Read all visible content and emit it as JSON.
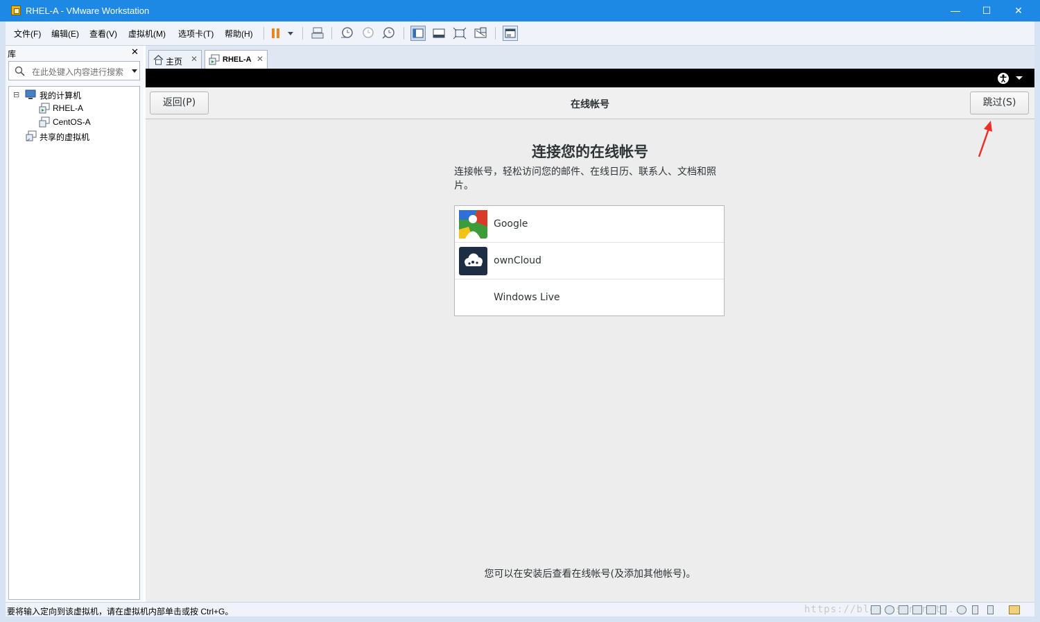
{
  "window": {
    "title": "RHEL-A - VMware Workstation",
    "minimize": "—",
    "maximize": "☐",
    "close": "✕"
  },
  "menu": [
    "文件(F)",
    "编辑(E)",
    "查看(V)",
    "虚拟机(M)",
    "选项卡(T)",
    "帮助(H)"
  ],
  "toolbar": {
    "icons": [
      "pause-icon",
      "send-keys-icon",
      "snapshot-take-icon",
      "snapshot-revert-icon",
      "snapshot-manager-icon",
      "library-view-icon",
      "console-view-icon",
      "fullscreen-icon",
      "unity-icon",
      "thumbnail-icon"
    ]
  },
  "library": {
    "title": "库",
    "close": "✕",
    "search_placeholder": "在此处键入内容进行搜索",
    "tree": {
      "root": "我的计算机",
      "expander": "⊟",
      "vms": [
        "RHEL-A",
        "CentOS-A"
      ],
      "shared": "共享的虚拟机"
    }
  },
  "tabs": [
    {
      "label": "主页",
      "close": "✕",
      "active": false
    },
    {
      "label": "RHEL-A",
      "close": "✕",
      "active": true
    }
  ],
  "vm": {
    "header": {
      "back_label": "返回(P)",
      "title": "在线帐号",
      "skip_label": "跳过(S)"
    },
    "heading": "连接您的在线帐号",
    "subtext": "连接帐号，轻松访问您的邮件、在线日历、联系人、文档和照片。",
    "providers": [
      "Google",
      "ownCloud",
      "Windows Live"
    ],
    "footnote": "您可以在安装后查看在线帐号(及添加其他帐号)。"
  },
  "status": {
    "text": "要将输入定向到该虚拟机，请在虚拟机内部单击或按 Ctrl+G。",
    "watermark": "https://blog.csdn.net/..."
  },
  "colors": {
    "titlebar": "#1e88e5",
    "annotation_arrow": "#ee2e24"
  }
}
